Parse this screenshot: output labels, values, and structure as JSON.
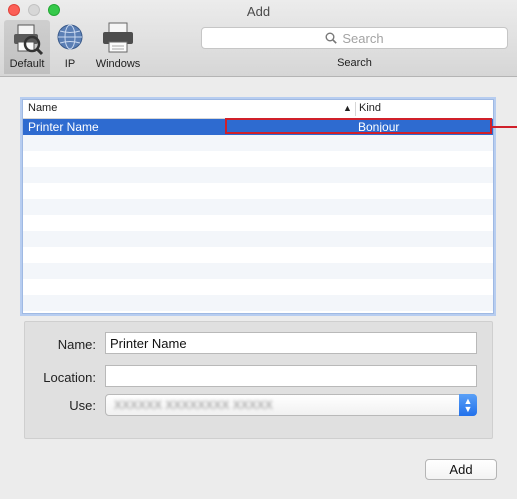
{
  "window": {
    "title": "Add"
  },
  "toolbar": {
    "default_label": "Default",
    "ip_label": "IP",
    "windows_label": "Windows",
    "search_placeholder": "Search",
    "search_label": "Search"
  },
  "table": {
    "headers": {
      "name": "Name",
      "kind": "Kind"
    },
    "rows": [
      {
        "name": "Printer Name",
        "kind": "Bonjour",
        "selected": true
      }
    ]
  },
  "form": {
    "name_label": "Name:",
    "name_value": "Printer Name",
    "location_label": "Location:",
    "location_value": "",
    "use_label": "Use:",
    "use_value": "XXXXXX XXXXXXXX XXXXX"
  },
  "footer": {
    "add_label": "Add"
  },
  "colors": {
    "selection": "#2e6bd0",
    "highlight_border": "#d0202a",
    "close": "#fc5f57",
    "maximize": "#35c94a"
  }
}
